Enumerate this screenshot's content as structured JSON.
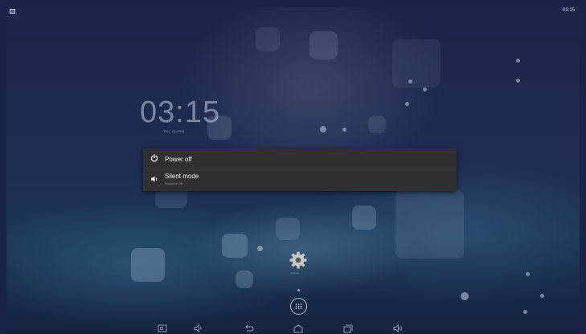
{
  "status_bar": {
    "time": "03:15",
    "notification_icon": "screenshot-icon"
  },
  "lockscreen": {
    "clock": "03:15",
    "date": "THU, 18 APRIL"
  },
  "power_menu": {
    "items": [
      {
        "label": "Power off",
        "icon": "power-icon"
      },
      {
        "label": "Silent mode",
        "sublabel": "Sound is ON",
        "icon": "volume-icon"
      }
    ]
  },
  "home": {
    "shortcut_label": "Settings",
    "shortcut_icon": "gear-icon",
    "all_apps_icon": "all-apps-icon"
  },
  "nav_bar": {
    "buttons": [
      {
        "icon": "screenshot-icon"
      },
      {
        "icon": "volume-down-icon"
      },
      {
        "icon": "back-icon"
      },
      {
        "icon": "home-icon"
      },
      {
        "icon": "recent-apps-icon"
      },
      {
        "icon": "volume-up-icon"
      }
    ]
  },
  "colors": {
    "menu_bg": "#2e3033",
    "wallpaper": "#1f2c52",
    "text_primary": "#f1f1f1"
  }
}
